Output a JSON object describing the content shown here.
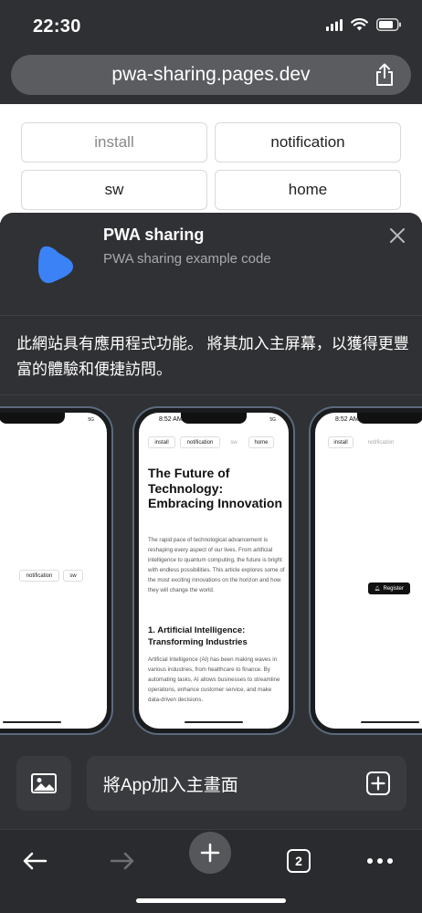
{
  "status": {
    "time": "22:30"
  },
  "browser": {
    "url": "pwa-sharing.pages.dev"
  },
  "page": {
    "buttons": [
      "install",
      "notification",
      "sw",
      "home"
    ]
  },
  "sheet": {
    "app_name": "PWA sharing",
    "app_description": "PWA sharing example code",
    "install_message": "此網站具有應用程式功能。 將其加入主屏幕，以獲得更豐富的體驗和便捷訪問。",
    "add_to_home_label": "將App加入主畫面",
    "icon_color": "#3b82f6"
  },
  "screenshots": {
    "left": {
      "buttons": [
        "notification",
        "sw"
      ]
    },
    "center": {
      "time": "8:52 AM",
      "signal": "5G",
      "buttons": [
        "install",
        "notification",
        "sw",
        "home"
      ],
      "title": "The Future of Technology: Embracing Innovation",
      "intro": "The rapid pace of technological advancement is reshaping every aspect of our lives. From artificial intelligence to quantum computing, the future is bright with endless possibilities. This article explores some of the most exciting innovations on the horizon and how they will change the world.",
      "section_title": "1. Artificial Intelligence: Transforming Industries",
      "section_text": "Artificial Intelligence (AI) has been making waves in various industries, from healthcare to finance. By automating tasks, AI allows businesses to streamline operations, enhance customer service, and make data-driven decisions."
    },
    "right": {
      "time": "8:52 AM",
      "buttons": [
        "install",
        "notification"
      ],
      "register_label": "Register"
    }
  },
  "toolbar": {
    "tab_count": "2"
  }
}
